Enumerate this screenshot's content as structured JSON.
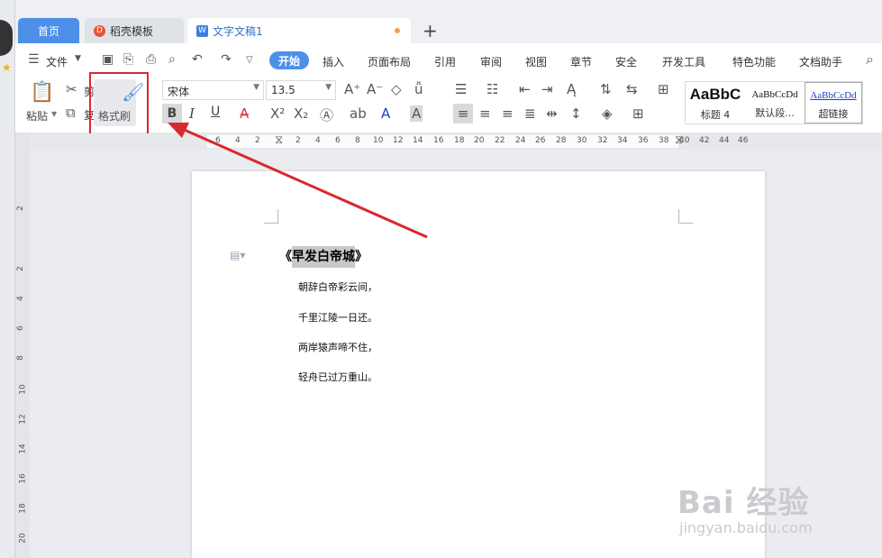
{
  "tabs": {
    "home": "首页",
    "template": "稻壳模板",
    "doc": "文字文稿1",
    "new_tab": "+"
  },
  "menu": {
    "file": "文件",
    "items": [
      "开始",
      "插入",
      "页面布局",
      "引用",
      "审阅",
      "视图",
      "章节",
      "安全",
      "开发工具",
      "特色功能",
      "文档助手"
    ]
  },
  "ribbon": {
    "paste": "粘贴",
    "cut": "剪切",
    "copy": "复制",
    "format_painter": "格式刷",
    "font_name": "宋体",
    "font_size": "13.5",
    "bold": "B",
    "italic": "I",
    "underline": "U",
    "styles": [
      {
        "sample": "AaBbC",
        "name": "标题 4"
      },
      {
        "sample": "AaBbCcDd",
        "name": "默认段..."
      },
      {
        "sample": "AaBbCcDd",
        "name": "超链接"
      }
    ]
  },
  "ruler": {
    "top": [
      "6",
      "4",
      "2",
      "2",
      "4",
      "6",
      "8",
      "10",
      "12",
      "14",
      "16",
      "18",
      "20",
      "22",
      "24",
      "26",
      "28",
      "30",
      "32",
      "34",
      "36",
      "38",
      "40",
      "42",
      "44",
      "46"
    ],
    "left": [
      "2",
      "2",
      "4",
      "6",
      "8",
      "10",
      "12",
      "14",
      "16",
      "18",
      "20"
    ]
  },
  "document": {
    "title_open": "《",
    "title_selected": "早发白帝城",
    "title_close": "》",
    "lines": [
      "朝辞白帝彩云间，",
      "千里江陵一日还。",
      "两岸猿声啼不住，",
      "轻舟已过万重山。"
    ]
  },
  "watermark": {
    "brand": "Bai 经验",
    "url": "jingyan.baidu.com"
  },
  "colors": {
    "accent": "#4e8fe8",
    "annotation": "#d9282e",
    "tab_bar": "#eef0f3"
  }
}
